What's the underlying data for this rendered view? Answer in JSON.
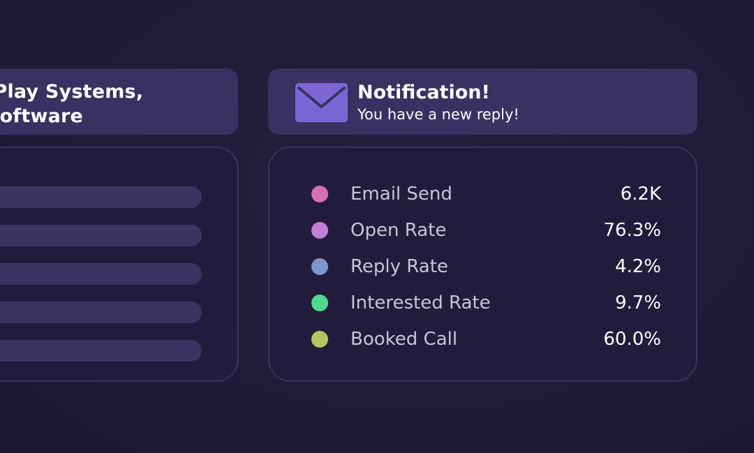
{
  "company_card": {
    "name": "·Play Systems, Software"
  },
  "notification": {
    "icon": "mail-icon",
    "title": "Notification!",
    "message": "You have a new reply!",
    "accent_color": "#7b67d3"
  },
  "stats": [
    {
      "label": "Email Send",
      "value": "6.2K",
      "color": "#d66fb0"
    },
    {
      "label": "Open Rate",
      "value": "76.3%",
      "color": "#c37fd3"
    },
    {
      "label": "Reply Rate",
      "value": "4.2%",
      "color": "#7f95cc"
    },
    {
      "label": "Interested Rate",
      "value": "9.7%",
      "color": "#4ed98f"
    },
    {
      "label": "Booked Call",
      "value": "60.0%",
      "color": "#b5c65f"
    }
  ],
  "colors": {
    "background": "#211c3a",
    "card": "#3a3061",
    "panel_border": "#3a3460",
    "placeholder_bar": "#3b3462"
  }
}
